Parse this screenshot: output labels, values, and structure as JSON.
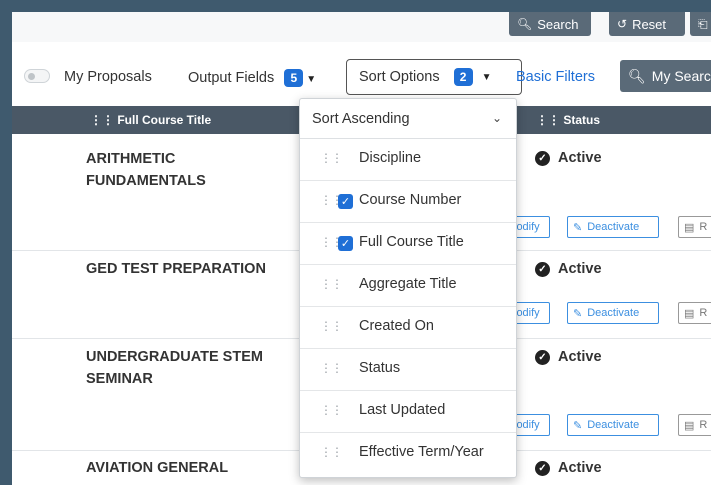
{
  "top_buttons": {
    "search": "Search",
    "reset": "Reset"
  },
  "toolbar": {
    "my_proposals": "My Proposals",
    "output_fields": "Output Fields",
    "output_fields_count": "5",
    "sort_options": "Sort Options",
    "sort_options_count": "2",
    "basic_filters": "Basic Filters",
    "my_search": "My Search"
  },
  "table": {
    "headers": {
      "title": "Full Course Title",
      "status": "Status"
    },
    "rows": [
      {
        "title": "ARITHMETIC FUNDAMENTALS",
        "status": "Active"
      },
      {
        "title": "GED TEST PREPARATION",
        "status": "Active"
      },
      {
        "title": "UNDERGRADUATE STEM SEMINAR",
        "status": "Active"
      },
      {
        "title": "AVIATION GENERAL",
        "status": "Active"
      }
    ],
    "actions": {
      "modify": "lodify",
      "deactivate": "Deactivate",
      "third": "R"
    }
  },
  "sort_dropdown": {
    "direction": "Sort Ascending",
    "items": [
      {
        "label": "Discipline",
        "checked": false
      },
      {
        "label": "Course Number",
        "checked": true
      },
      {
        "label": "Full Course Title",
        "checked": true
      },
      {
        "label": "Aggregate Title",
        "checked": false
      },
      {
        "label": "Created On",
        "checked": false
      },
      {
        "label": "Status",
        "checked": false
      },
      {
        "label": "Last Updated",
        "checked": false
      },
      {
        "label": "Effective Term/Year",
        "checked": false
      }
    ]
  }
}
